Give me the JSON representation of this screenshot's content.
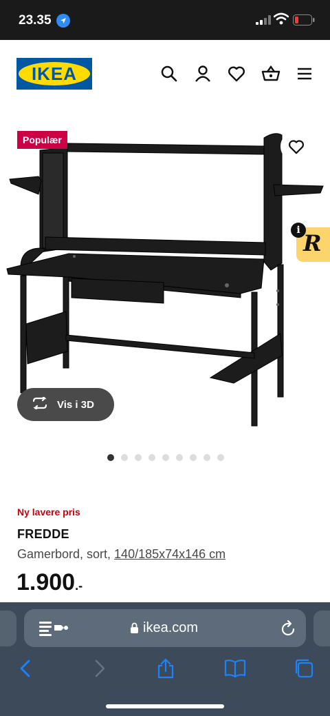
{
  "status": {
    "time": "23.35"
  },
  "header": {
    "logo_text": "IKEA",
    "brand_blue": "#0058a3",
    "brand_yellow": "#ffdb00"
  },
  "product": {
    "badge": "Populær",
    "view_3d": "Vis i 3D",
    "label": "Ny lavere pris",
    "name": "FREDDE",
    "description": "Gamerbord, sort, ",
    "dimensions": "140/185x74x146 cm",
    "price": "1.900",
    "price_suffix": ".-",
    "image_count": 9,
    "active_image": 1
  },
  "browser": {
    "url": "ikea.com"
  },
  "colors": {
    "badge_red": "#cc0044",
    "price_label_red": "#cc0008"
  }
}
